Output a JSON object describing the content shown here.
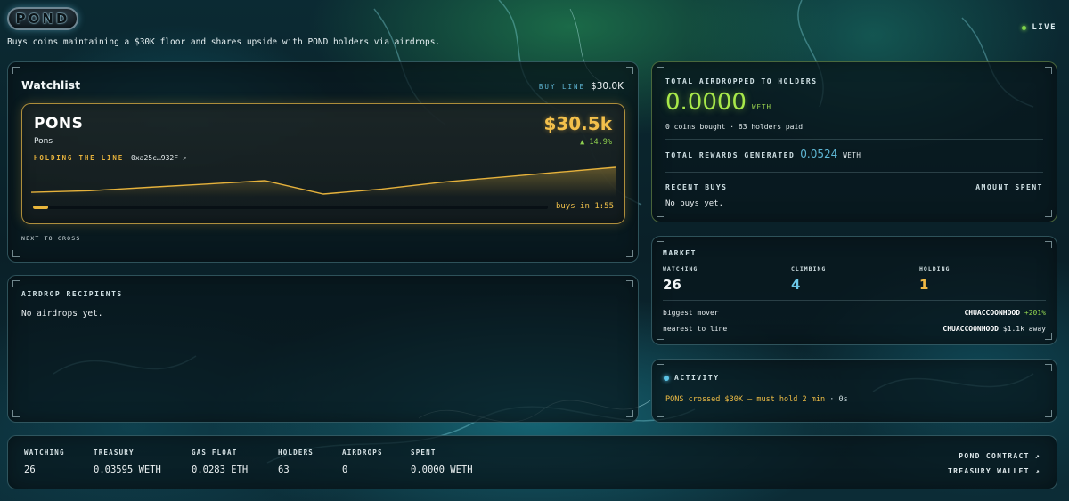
{
  "header": {
    "logo_text": "POND",
    "tagline": "Buys coins maintaining a $30K floor and shares upside with POND holders via airdrops.",
    "live_label": "LIVE"
  },
  "watchlist": {
    "title": "Watchlist",
    "buy_line_label": "BUY LINE",
    "buy_line_value": "$30.0K",
    "card": {
      "symbol": "PONS",
      "name": "Pons",
      "status": "HOLDING THE LINE",
      "address": "0xa25c…932F ↗",
      "price": "$30.5k",
      "change": "▲ 14.9%",
      "buys_in": "buys in 1:55",
      "progress": 0.03,
      "sparkline": [
        10,
        11,
        13,
        15,
        17,
        9,
        12,
        16,
        19,
        22,
        25
      ]
    },
    "next_label": "NEXT TO CROSS"
  },
  "airdrop_recipients": {
    "title": "AIRDROP RECIPIENTS",
    "empty_text": "No airdrops yet."
  },
  "totals": {
    "label": "TOTAL AIRDROPPED TO HOLDERS",
    "amount": "0.0000",
    "unit": "WETH",
    "summary": "0 coins bought · 63 holders paid",
    "rewards_label": "TOTAL REWARDS GENERATED",
    "rewards_value": "0.0524",
    "rewards_unit": "WETH",
    "recent_buys_label": "RECENT BUYS",
    "amount_spent_label": "AMOUNT SPENT",
    "recent_empty": "No buys yet."
  },
  "market": {
    "title": "MARKET",
    "stats": [
      {
        "label": "WATCHING",
        "value": "26",
        "color": "#f2f6f7"
      },
      {
        "label": "CLIMBING",
        "value": "4",
        "color": "#6cc8e8"
      },
      {
        "label": "HOLDING",
        "value": "1",
        "color": "#f0b944"
      }
    ],
    "biggest_mover_label": "biggest mover",
    "biggest_mover_coin": "CHUACCOONHOOD",
    "biggest_mover_change": "+201%",
    "nearest_label": "nearest to line",
    "nearest_coin": "CHUACCOONHOOD",
    "nearest_value": "$1.1k away"
  },
  "activity": {
    "title": "ACTIVITY",
    "entries": [
      {
        "message": "PONS crossed $30K — must hold 2 min",
        "time": "0s"
      }
    ]
  },
  "footer": {
    "stats": [
      {
        "label": "WATCHING",
        "value": "26"
      },
      {
        "label": "TREASURY",
        "value": "0.03595 WETH"
      },
      {
        "label": "GAS FLOAT",
        "value": "0.0283 ETH"
      },
      {
        "label": "HOLDERS",
        "value": "63"
      },
      {
        "label": "AIRDROPS",
        "value": "0"
      },
      {
        "label": "SPENT",
        "value": "0.0000 WETH"
      }
    ],
    "links": [
      "POND CONTRACT ↗",
      "TREASURY WALLET ↗"
    ]
  },
  "colors": {
    "accent_gold": "#f0b944",
    "accent_green": "#a8e84a",
    "accent_cyan": "#5fb8d6"
  }
}
